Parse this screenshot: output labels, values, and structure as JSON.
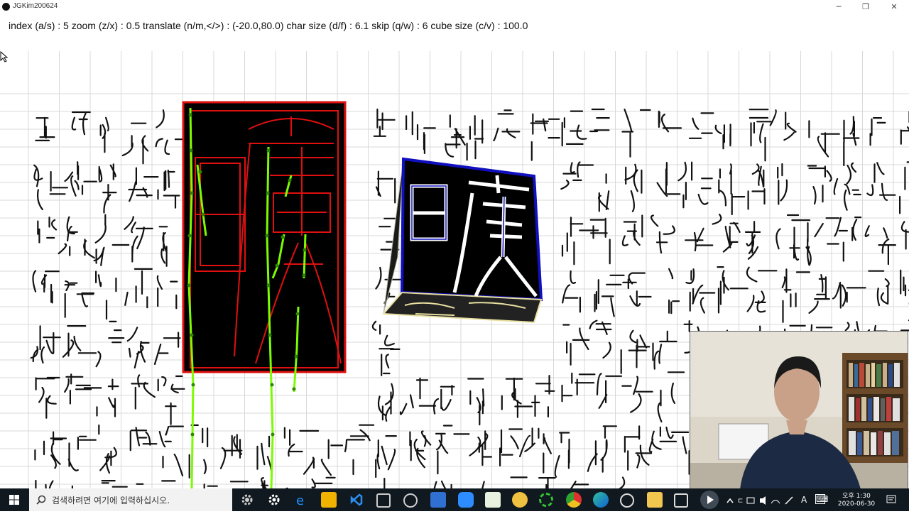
{
  "window": {
    "title": "JGKim200624",
    "minimize_label": "─",
    "restore_label": "❐",
    "close_label": "✕"
  },
  "status": {
    "text": "index (a/s) : 5 zoom (z/x) : 0.5 translate (n/m,</>) : (-20.0,80.0) char size (d/f) : 6.1 skip (q/w) : 6 cube size (c/v) : 100.0",
    "index": 5,
    "zoom": 0.5,
    "translate": [
      -20.0,
      80.0
    ],
    "char_size": 6.1,
    "skip": 6,
    "cube_size": 100.0
  },
  "colors": {
    "seal_ink": "#111111",
    "highlight_red": "#e01010",
    "trace_green": "#7cfc00",
    "cube_blue": "#1010c0",
    "grid": "#d8d8d8",
    "taskbar": "#101820"
  },
  "taskbar": {
    "search_placeholder": "검색하려면 여기에 입력하십시오.",
    "time": "오후 1:30",
    "date": "2020-06-30",
    "ime_label": "A",
    "icons": [
      "settings-icon",
      "gear-icon",
      "edge-legacy-icon",
      "folder-icon",
      "vscode-icon",
      "app-icon",
      "app-icon",
      "app-icon",
      "zoom-icon",
      "notepad-icon",
      "chrome-canary-icon",
      "green-app-icon",
      "chrome-icon",
      "edge-icon",
      "app-icon",
      "file-explorer-icon",
      "app-icon",
      "media-player-icon"
    ]
  }
}
